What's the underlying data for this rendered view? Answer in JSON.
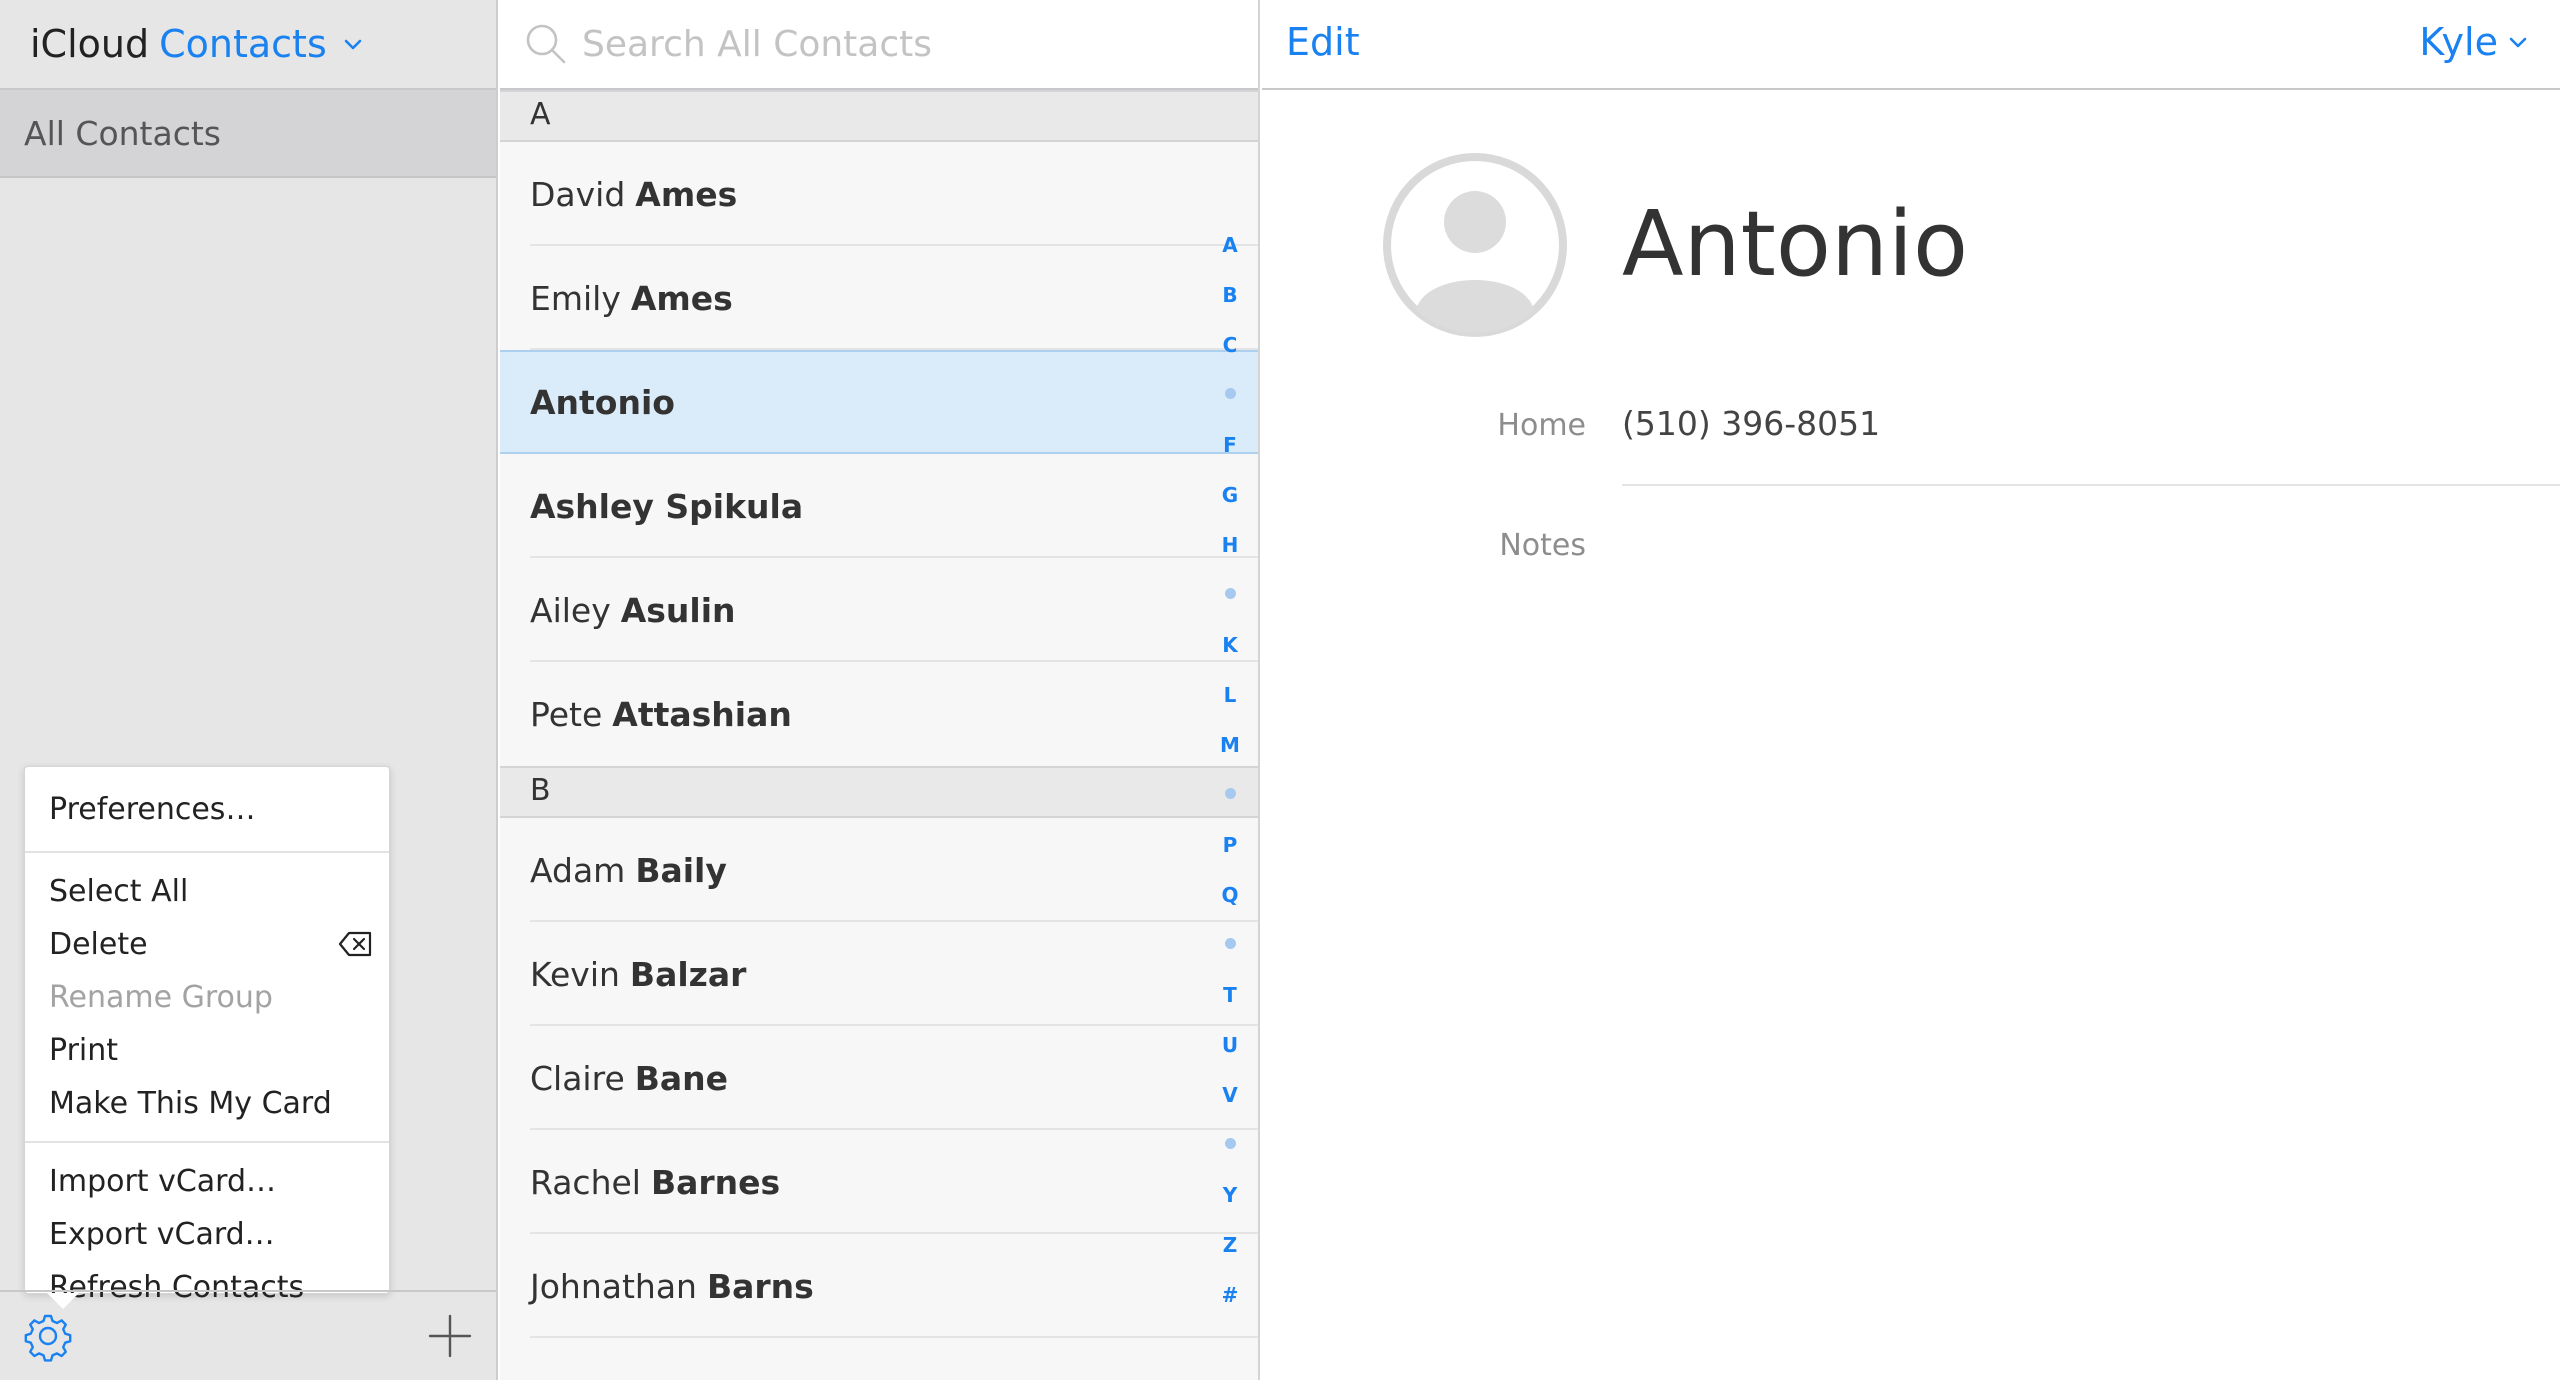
{
  "sidebar": {
    "app_name": "iCloud",
    "app_section": "Contacts",
    "groups": [
      "All Contacts"
    ],
    "menu": {
      "items": [
        {
          "label": "Preferences…",
          "enabled": true
        },
        {
          "label": "Select All",
          "enabled": true
        },
        {
          "label": "Delete",
          "enabled": true,
          "icon": "delete-key-icon"
        },
        {
          "label": "Rename Group",
          "enabled": false
        },
        {
          "label": "Print",
          "enabled": true
        },
        {
          "label": "Make This My Card",
          "enabled": true
        },
        {
          "label": "Import vCard…",
          "enabled": true
        },
        {
          "label": "Export vCard…",
          "enabled": true
        },
        {
          "label": "Refresh Contacts",
          "enabled": true
        }
      ]
    },
    "footer": {
      "settings_icon": "gear-icon",
      "add_icon": "plus-icon"
    }
  },
  "list": {
    "search_placeholder": "Search All Contacts",
    "sections": [
      {
        "letter": "A",
        "contacts": [
          {
            "first": "David",
            "last": "Ames"
          },
          {
            "first": "Emily",
            "last": "Ames"
          },
          {
            "first": "",
            "last": "Antonio",
            "selected": true
          },
          {
            "first": "",
            "last": "Ashley Spikula"
          },
          {
            "first": "Ailey",
            "last": "Asulin"
          },
          {
            "first": "Pete",
            "last": "Attashian"
          }
        ]
      },
      {
        "letter": "B",
        "contacts": [
          {
            "first": "Adam",
            "last": "Baily"
          },
          {
            "first": "Kevin",
            "last": "Balzar"
          },
          {
            "first": "Claire",
            "last": "Bane"
          },
          {
            "first": "Rachel",
            "last": "Barnes"
          },
          {
            "first": "Johnathan",
            "last": "Barns"
          }
        ]
      }
    ],
    "index": [
      "A",
      "B",
      "C",
      "•",
      "F",
      "G",
      "H",
      "•",
      "K",
      "L",
      "M",
      "•",
      "P",
      "Q",
      "•",
      "T",
      "U",
      "V",
      "•",
      "Y",
      "Z",
      "#"
    ]
  },
  "detail": {
    "edit_label": "Edit",
    "user_name": "Kyle",
    "contact_name": "Antonio",
    "fields": [
      {
        "label": "Home",
        "value": "(510) 396-8051"
      },
      {
        "label": "Notes",
        "value": ""
      }
    ]
  },
  "colors": {
    "accent": "#1a82f0",
    "selection": "#daebf9",
    "sidebar_bg": "#e6e6e7"
  }
}
